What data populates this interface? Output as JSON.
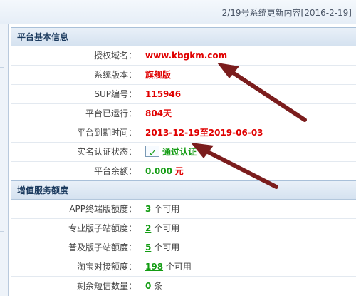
{
  "header": {
    "notice": "2/19号系统更新内容[2016-2-19]"
  },
  "basic_info": {
    "title": "平台基本信息",
    "rows": [
      {
        "label": "授权域名：",
        "value": "www.kbgkm.com"
      },
      {
        "label": "系统版本：",
        "value": "旗舰版"
      },
      {
        "label": "SUP编号：",
        "value": "115946"
      },
      {
        "label": "平台已运行：",
        "value": "804天"
      },
      {
        "label": "平台到期时间：",
        "value": "2013-12-19至2019-06-03"
      },
      {
        "label": "实名认证状态：",
        "value": "通过认证",
        "icon": "certificate-icon"
      },
      {
        "label": "平台余额：",
        "value": "0.000",
        "unit": "元"
      }
    ]
  },
  "value_added": {
    "title": "增值服务额度",
    "rows": [
      {
        "label": "APP终端版额度：",
        "value": "3",
        "unit": "个可用"
      },
      {
        "label": "专业版子站额度：",
        "value": "2",
        "unit": "个可用"
      },
      {
        "label": "普及版子站额度：",
        "value": "5",
        "unit": "个可用"
      },
      {
        "label": "淘宝对接额度：",
        "value": "198",
        "unit": "个可用"
      },
      {
        "label": "剩余短信数量：",
        "value": "0",
        "unit": "条"
      }
    ]
  },
  "colors": {
    "accent_red": "#e00000",
    "accent_green": "#139c13",
    "arrow": "#7b1d1d"
  }
}
